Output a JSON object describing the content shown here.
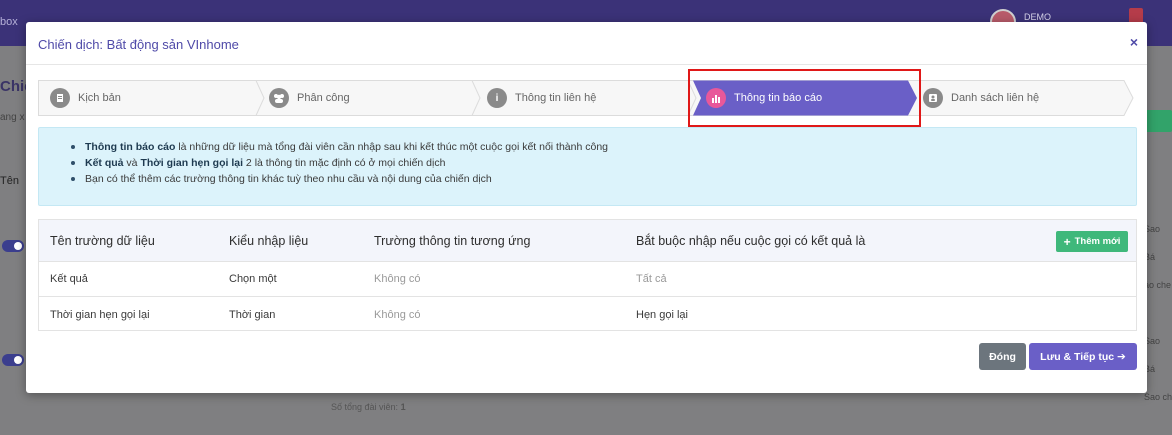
{
  "background": {
    "brand_fragment": "box",
    "avatar_initials": "DE",
    "user_label": "DEMO",
    "left_heading_fragment": "Chiế",
    "left_sub_fragment": "ang x",
    "left_col_fragment": "Tên",
    "side_labels": [
      "Sao",
      "Bá",
      "ảo che",
      "Sao",
      "Bá",
      "Sao che"
    ],
    "bottom_label": "Số tổng đài viên:",
    "bottom_value": "1"
  },
  "modal": {
    "title": "Chiến dịch: Bất động sản VInhome",
    "close_symbol": "×"
  },
  "stepper": {
    "steps": [
      {
        "label": "Kịch bản",
        "icon": "document-icon"
      },
      {
        "label": "Phân công",
        "icon": "team-icon"
      },
      {
        "label": "Thông tin liên hệ",
        "icon": "info-icon"
      },
      {
        "label": "Thông tin báo cáo",
        "icon": "chart-icon",
        "active": true
      },
      {
        "label": "Danh sách liên hệ",
        "icon": "contact-list-icon"
      }
    ]
  },
  "info": {
    "line1_bold": "Thông tin báo cáo",
    "line1_rest": " là những dữ liệu mà tổng đài viên cần nhập sau khi kết thúc một cuộc gọi kết nối thành công",
    "line2_bold1": "Kết quả",
    "line2_mid": " và ",
    "line2_bold2": "Thời gian hẹn gọi lại",
    "line2_rest": " 2 là thông tin mặc định có ở mọi chiến dịch",
    "line3": "Bạn có thể thêm các trường thông tin khác tuỳ theo nhu cầu và nội dung của chiến dịch"
  },
  "table": {
    "headers": [
      "Tên trường dữ liệu",
      "Kiểu nhập liệu",
      "Trường thông tin tương ứng",
      "Bắt buộc nhập nếu cuộc gọi có kết quả là"
    ],
    "add_button": "Thêm mới",
    "rows": [
      [
        "Kết quả",
        "Chọn một",
        "Không có",
        "Tất cả"
      ],
      [
        "Thời gian hẹn gọi lại",
        "Thời gian",
        "Không có",
        "Hẹn gọi lại"
      ]
    ]
  },
  "footer": {
    "close_label": "Đóng",
    "next_label": "Lưu & Tiếp tục ➔"
  },
  "colors": {
    "accent": "#6a5fc7",
    "active_step": "#6a5fc7",
    "success": "#3fb87b",
    "highlight": "#e01818"
  }
}
